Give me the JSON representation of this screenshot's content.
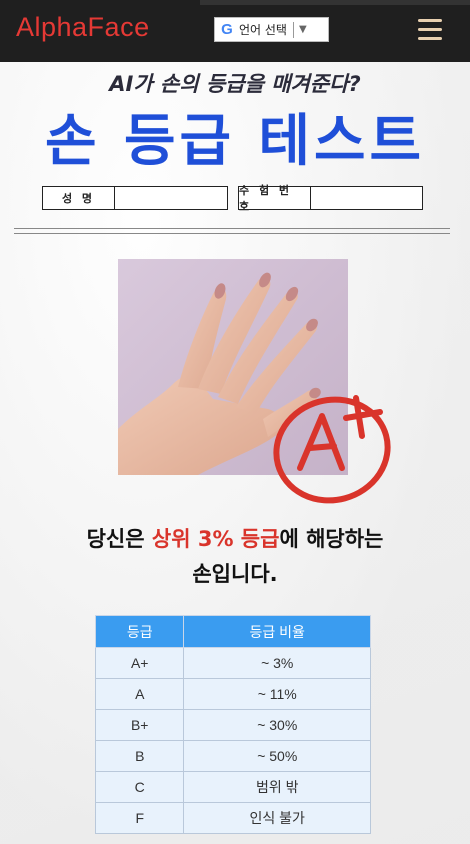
{
  "header": {
    "logo": "AlphaFace",
    "language_button": {
      "google_glyph": "G",
      "label": "언어 선택",
      "arrow": "▼"
    },
    "menu_icon": "hamburger-icon"
  },
  "main": {
    "subtitle": "AI가 손의 등급을 매겨준다?",
    "title": "손 등급 테스트",
    "fields": [
      {
        "label": "성 명",
        "value": ""
      },
      {
        "label": "수 험 번 호",
        "value": ""
      }
    ],
    "result": {
      "prefix": "당신은 ",
      "highlight": "상위 3% 등급",
      "suffix": "에 해당하는",
      "line2": "손입니다."
    },
    "grade_mark": {
      "text": "A+",
      "color": "#d9342b"
    }
  },
  "grade_table": {
    "headers": [
      "등급",
      "등급 비율"
    ],
    "rows": [
      [
        "A+",
        "~ 3%"
      ],
      [
        "A",
        "~ 11%"
      ],
      [
        "B+",
        "~ 30%"
      ],
      [
        "B",
        "~ 50%"
      ],
      [
        "C",
        "범위 밖"
      ],
      [
        "F",
        "인식 불가"
      ]
    ]
  },
  "colors": {
    "header_bg": "#1f1f1f",
    "logo": "#e53935",
    "title": "#1f4fd8",
    "highlight": "#d9342b",
    "table_header": "#3a9cf0",
    "table_cell": "#e8f2fc"
  }
}
